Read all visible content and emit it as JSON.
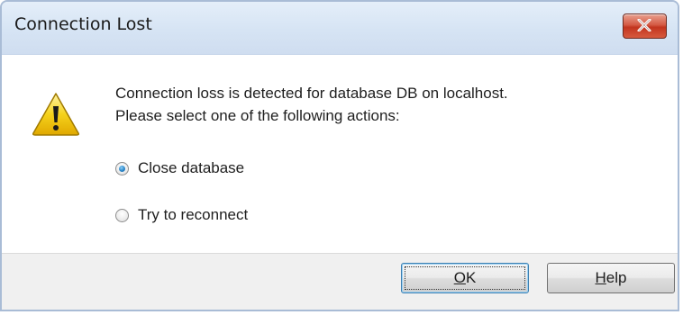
{
  "dialog": {
    "title": "Connection Lost",
    "close_icon": "close-icon",
    "warning_icon": "warning-icon",
    "message_line1": "Connection loss is detected for database DB on localhost.",
    "message_line2": "Please select one of the following actions:",
    "options": [
      {
        "label": "Close database",
        "selected": true
      },
      {
        "label": "Try to reconnect",
        "selected": false
      }
    ],
    "buttons": {
      "ok": {
        "accel": "O",
        "rest": "K"
      },
      "help": {
        "accel": "H",
        "rest": "elp"
      }
    }
  },
  "colors": {
    "close_button": "#c2351f",
    "radio_selected": "#2a86c9",
    "warning_yellow": "#f5d21b"
  }
}
